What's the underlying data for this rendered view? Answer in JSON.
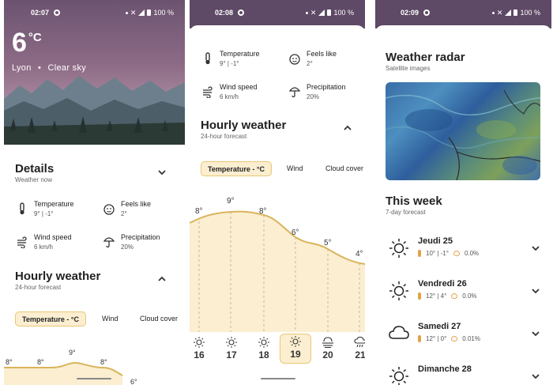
{
  "screens": [
    {
      "status": {
        "time": "02:07",
        "battery": "100 %"
      },
      "hero": {
        "temperature": "6",
        "unit": "°C",
        "location": "Lyon",
        "condition": "Clear sky"
      },
      "details": {
        "title": "Details",
        "subtitle": "Weather now",
        "metrics": [
          {
            "label": "Temperature",
            "value": "9° | -1°",
            "icon": "thermometer-icon"
          },
          {
            "label": "Feels like",
            "value": "2°",
            "icon": "face-icon"
          },
          {
            "label": "Wind speed",
            "value": "6 km/h",
            "icon": "wind-icon"
          },
          {
            "label": "Precipitation",
            "value": "20%",
            "icon": "umbrella-icon"
          }
        ]
      },
      "hourly": {
        "title": "Hourly weather",
        "subtitle": "24-hour forecast",
        "chips": [
          "Temperature - °C",
          "Wind",
          "Cloud cover"
        ],
        "visible_labels": [
          "8°",
          "8°",
          "9°",
          "8°",
          "6°"
        ]
      }
    },
    {
      "status": {
        "time": "02:08",
        "battery": "100 %"
      },
      "details": {
        "metrics": [
          {
            "label": "Temperature",
            "value": "9° | -1°"
          },
          {
            "label": "Feels like",
            "value": "2°"
          },
          {
            "label": "Wind speed",
            "value": "6 km/h"
          },
          {
            "label": "Precipitation",
            "value": "20%"
          }
        ]
      },
      "hourly": {
        "title": "Hourly weather",
        "subtitle": "24-hour forecast",
        "chips": [
          "Temperature - °C",
          "Wind",
          "Cloud cover"
        ],
        "temps": [
          "8°",
          "9°",
          "8°",
          "6°",
          "5°",
          "4°"
        ],
        "hours": [
          "16",
          "17",
          "18",
          "19",
          "20",
          "21"
        ],
        "hour_icons": [
          "sun-icon",
          "sun-icon",
          "sun-icon",
          "sun-icon",
          "fog-icon",
          "rain-cloud-icon"
        ],
        "selected_hour": "19"
      }
    },
    {
      "status": {
        "time": "02:09",
        "battery": "100 %"
      },
      "radar": {
        "title": "Weather radar",
        "subtitle": "Satellite images"
      },
      "week": {
        "title": "This week",
        "subtitle": "7-day forecast",
        "days": [
          {
            "name": "Jeudi 25",
            "temps": "10° | -1°",
            "precip": "0.0%",
            "icon": "sun-icon"
          },
          {
            "name": "Vendredi 26",
            "temps": "12° | 4°",
            "precip": "0.0%",
            "icon": "sun-icon"
          },
          {
            "name": "Samedi 27",
            "temps": "12° | 0°",
            "precip": "0.01%",
            "icon": "cloud-icon"
          },
          {
            "name": "Dimanche 28",
            "icon": "sun-icon"
          }
        ]
      }
    }
  ],
  "colors": {
    "chip_bg": "#fbeed1",
    "chip_border": "#e9c773",
    "chart_fill": "#fbeed1",
    "chart_line": "#d9b45a",
    "header_purple": "#5e4966"
  }
}
